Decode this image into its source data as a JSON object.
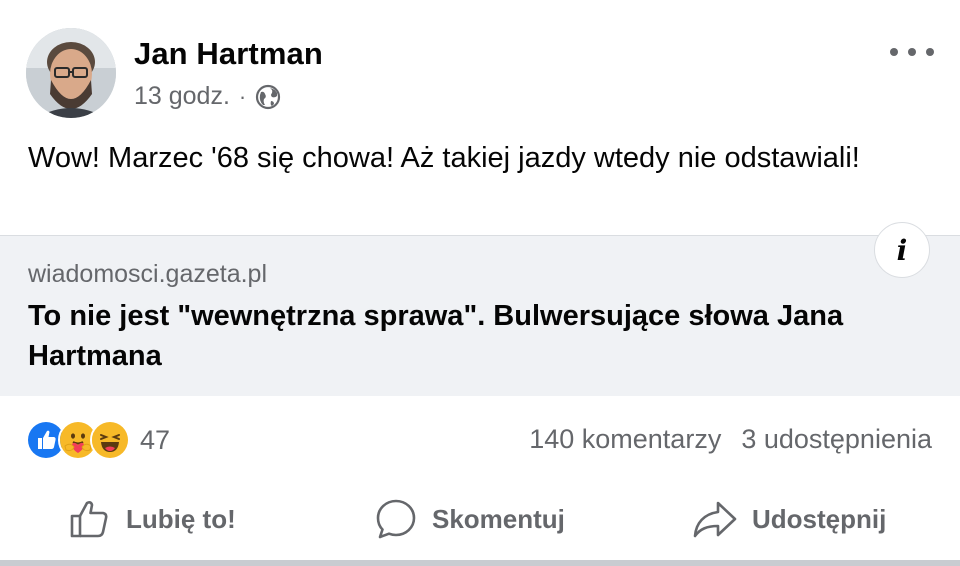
{
  "post": {
    "author": "Jan Hartman",
    "time": "13 godz.",
    "separator": "·",
    "audience_icon": "globe-icon",
    "text": "Wow! Marzec '68 się chowa! Aż takiej jazdy wtedy nie odstawiali!"
  },
  "link_preview": {
    "domain": "wiadomosci.gazeta.pl",
    "title": "To nie jest \"wewnętrzna sprawa\". Bulwersujące słowa Jana Hartmana",
    "info_label": "i"
  },
  "engagement": {
    "reaction_icons": [
      "like-icon",
      "care-icon",
      "haha-icon"
    ],
    "reaction_count": "47",
    "comments": "140 komentarzy",
    "shares": "3 udostępnienia"
  },
  "actions": {
    "like": "Lubię to!",
    "comment": "Skomentuj",
    "share": "Udostępnij"
  },
  "colors": {
    "text_primary": "#050505",
    "text_secondary": "#65676b",
    "like_blue": "#1877f2",
    "reaction_yellow": "#f7b928",
    "card_bg": "#f0f2f5"
  }
}
